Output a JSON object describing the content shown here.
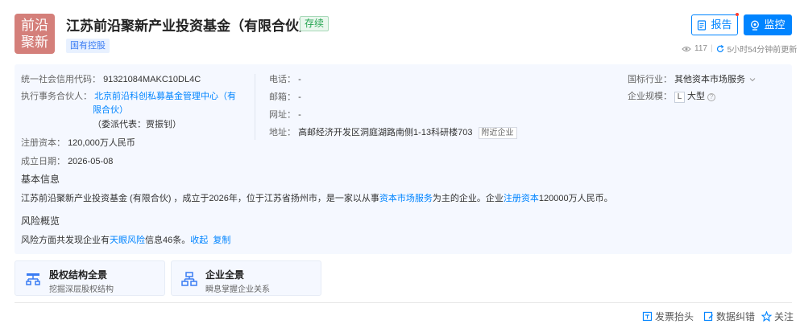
{
  "logo": {
    "line1": "前沿",
    "line2": "聚新"
  },
  "company": {
    "name": "江苏前沿聚新产业投资基金（有限合伙）",
    "status": "存续",
    "owner_tag": "国有控股"
  },
  "actions": {
    "report": "报告",
    "monitor": "监控"
  },
  "meta": {
    "views": "117",
    "updated": "5小时54分钟前更新"
  },
  "info": {
    "credit_code_label": "统一社会信用代码：",
    "credit_code": "91321084MAKC10DL4C",
    "partner_label": "执行事务合伙人：",
    "partner_line1": "北京前沿科创私募基金管理中心（有",
    "partner_line2": "限合伙）",
    "partner_rep": "（委派代表：贾振钊）",
    "capital_label": "注册资本：",
    "capital": "120,000万人民币",
    "founded_label": "成立日期：",
    "founded": "2026-05-08",
    "phone_label": "电话：",
    "phone": "-",
    "email_label": "邮箱：",
    "email": "-",
    "website_label": "网址：",
    "website": "-",
    "address_label": "地址：",
    "address": "高邮经济开发区洞庭湖路南侧1-13科研楼703",
    "nearby": "附近企业",
    "industry_label": "国标行业：",
    "industry": "其他资本市场服务",
    "scale_label": "企业规模：",
    "scale_letter": "L",
    "scale": "大型"
  },
  "basic": {
    "heading": "基本信息",
    "text1": "江苏前沿聚新产业投资基金 (有限合伙) ，成立于2026年，位于江苏省扬州市，是一家以从事",
    "link1": "资本市场服务",
    "text2": "为主的企业。企业",
    "link2": "注册资本",
    "text3": "120000万人民币。"
  },
  "risk": {
    "heading": "风险概览",
    "text1": "风险方面共发现企业有",
    "link1": "天眼风险",
    "text2": "信息46条。",
    "collapse": "收起",
    "copy": "复制"
  },
  "cards": [
    {
      "title": "股权结构全景",
      "subtitle": "挖掘深层股权结构"
    },
    {
      "title": "企业全景",
      "subtitle": "瞬息掌握企业关系"
    }
  ],
  "footer": {
    "invoice": "发票抬头",
    "correction": "数据纠错",
    "follow": "关注"
  },
  "colors": {
    "accent": "#0084ff",
    "status_green": "#27a552",
    "logo_bg": "#d47f7a"
  }
}
